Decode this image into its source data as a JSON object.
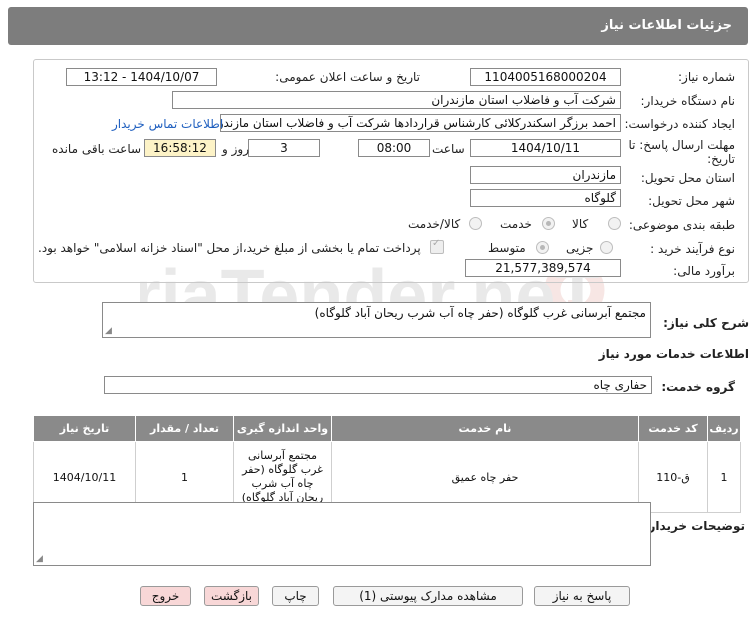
{
  "header": {
    "title": "جزئیات اطلاعات نیاز"
  },
  "fields": {
    "need_number_label": "شماره نیاز:",
    "need_number": "1104005168000204",
    "announce_label": "تاریخ و ساعت اعلان عمومی:",
    "announce_value": "1404/10/07 - 13:12",
    "buyer_label": "نام دستگاه خریدار:",
    "buyer": "شرکت آب و فاضلاب استان مازندران",
    "creator_label": "ایجاد کننده درخواست:",
    "creator": "احمد برزگر اسکندرکلائی کارشناس قراردادها شرکت آب و فاضلاب استان مازندران",
    "contact_link": "اطلاعات تماس خریدار",
    "deadline_label_1": "مهلت ارسال پاسخ: تا",
    "deadline_label_2": "تاریخ:",
    "deadline_date": "1404/10/11",
    "time_label": "ساعت",
    "deadline_time": "08:00",
    "days": "3",
    "days_label": "روز و",
    "remaining_time": "16:58:12",
    "remaining_label": "ساعت باقی مانده",
    "province_label": "استان محل تحویل:",
    "province": "مازندران",
    "city_label": "شهر محل تحویل:",
    "city": "گلوگاه",
    "category_label": "طبقه بندی موضوعی:",
    "category_options": [
      "کالا",
      "خدمت",
      "کالا/خدمت"
    ],
    "category_selected": "خدمت",
    "process_label": "نوع فرآیند خرید :",
    "process_options": [
      "جزیی",
      "متوسط"
    ],
    "process_selected": "متوسط",
    "payment_note": "پرداخت تمام یا بخشی از مبلغ خرید،از محل \"اسناد خزانه اسلامی\" خواهد بود.",
    "budget_label": "برآورد مالی:",
    "budget": "21,577,389,574"
  },
  "summary": {
    "label": "شرح کلی نیاز:",
    "text": "مجتمع آبرسانی غرب گلوگاه (حفر چاه آب شرب ریحان آباد گلوگاه)"
  },
  "services": {
    "section_title": "اطلاعات خدمات مورد نیاز",
    "group_label": "گروه خدمت:",
    "group_value": "حفاری چاه",
    "columns": [
      "ردیف",
      "کد خدمت",
      "نام خدمت",
      "واحد اندازه گیری",
      "تعداد / مقدار",
      "تاریخ نیاز"
    ],
    "rows": [
      [
        "1",
        "ق-110",
        "حفر چاه عمیق",
        "مجتمع آبرسانی غرب گلوگاه (حفر چاه آب شرب ریحان آباد گلوگاه)",
        "1",
        "1404/10/11"
      ]
    ]
  },
  "buyer_notes": {
    "label": "توضیحات خریدار:",
    "text": ""
  },
  "buttons": {
    "reply": "پاسخ به نیاز",
    "docs": "مشاهده مدارک پیوستی (1)",
    "print": "چاپ",
    "back": "بازگشت",
    "exit": "خروج"
  },
  "watermark": {
    "text": "AriaTender.neT"
  },
  "colors": {
    "header_bg": "#7d7d7d",
    "table_header_bg": "#8a8a8a",
    "link": "#1f5fbf",
    "danger_btn": "#f8d7d7"
  },
  "icons": [
    "watermark-logo-icon",
    "resize-handle-icon"
  ]
}
